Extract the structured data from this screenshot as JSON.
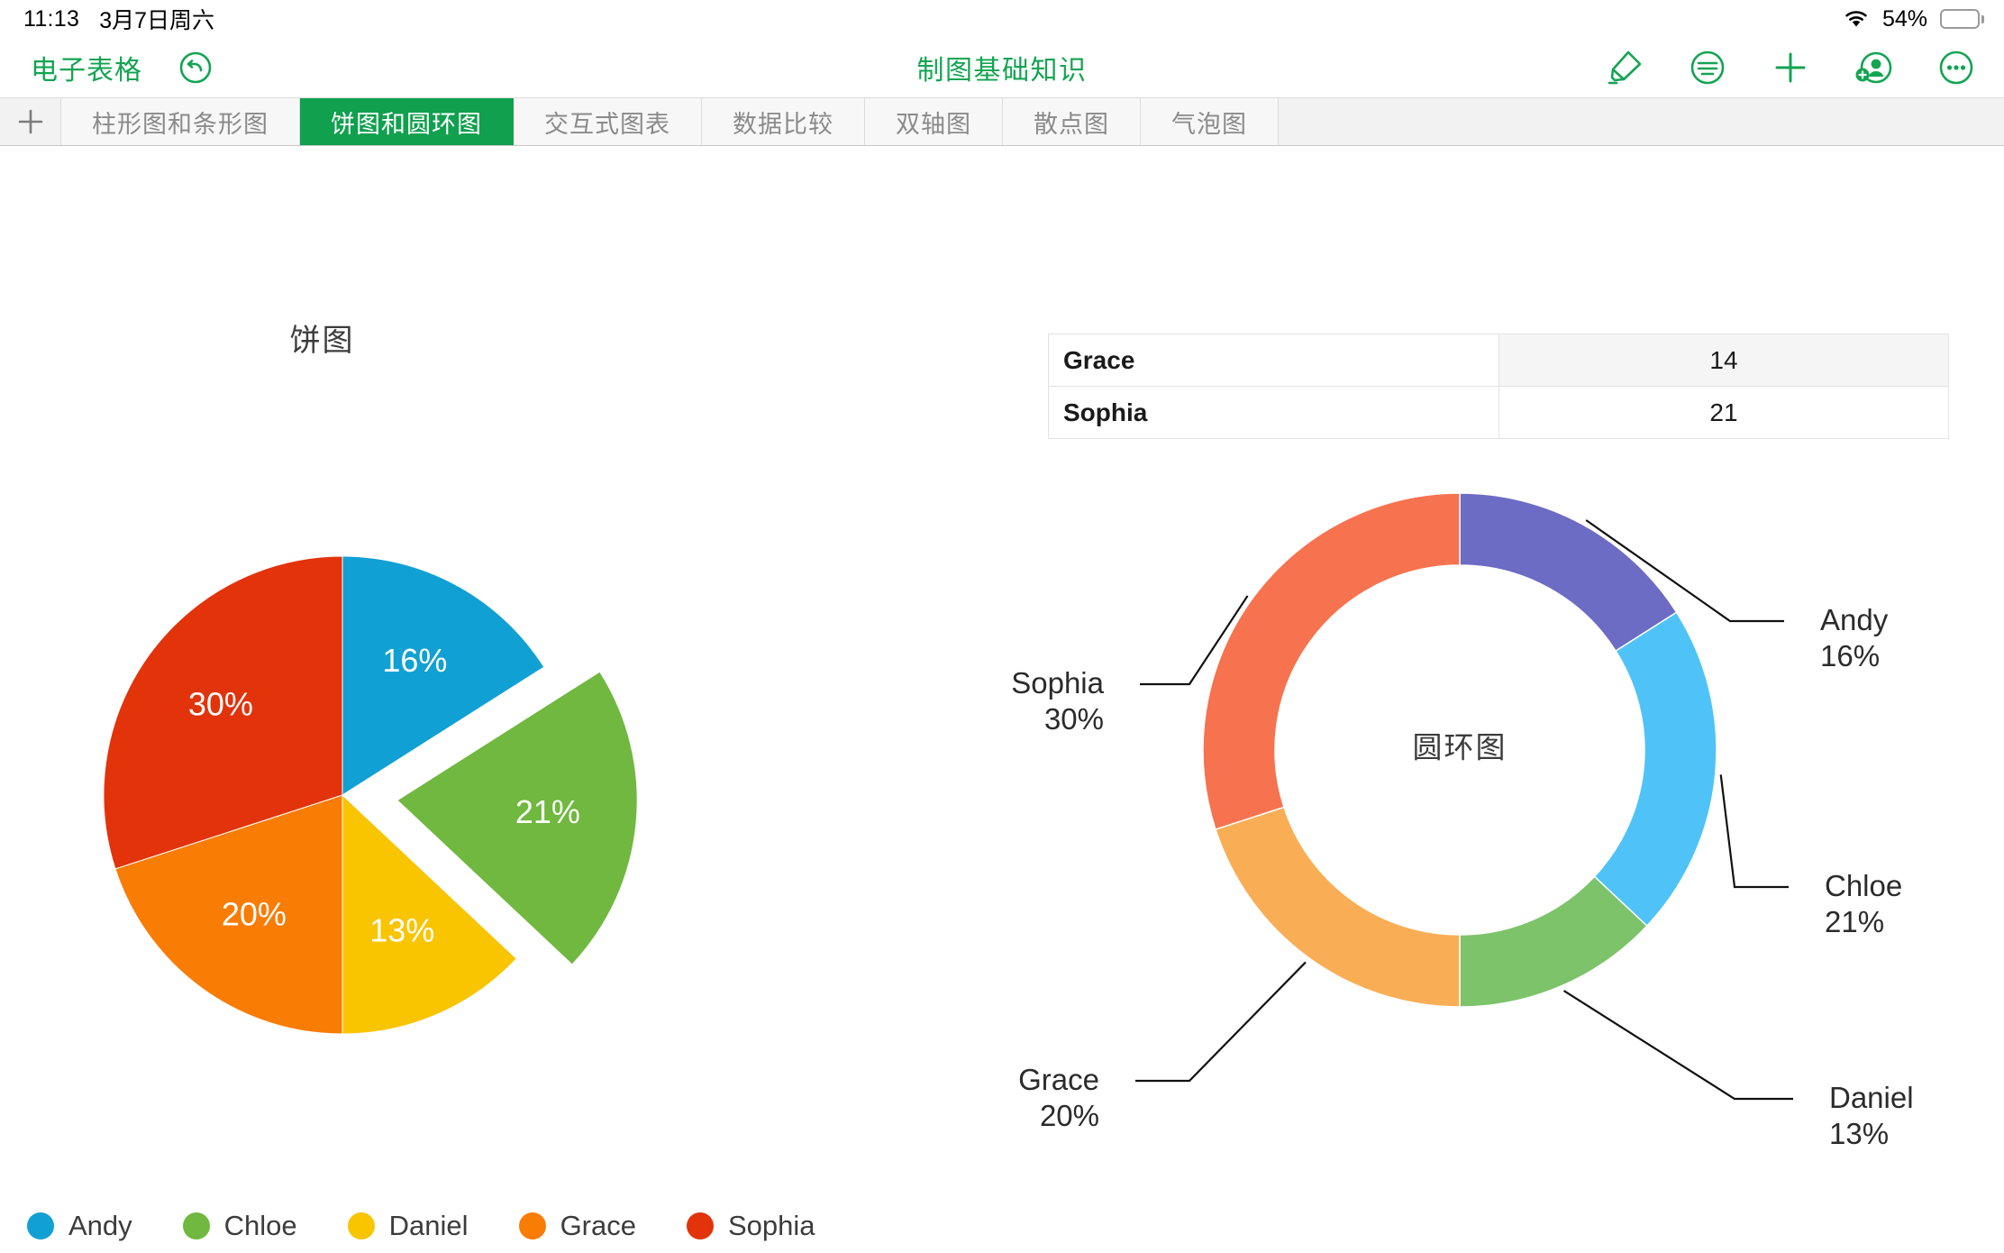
{
  "status_bar": {
    "time": "11:13",
    "date": "3月7日周六",
    "battery_percent": "54%",
    "battery_level": 54,
    "wifi_icon": "wifi-icon",
    "battery_icon": "battery-icon"
  },
  "toolbar": {
    "app_name": "电子表格",
    "undo_icon": "undo-icon",
    "doc_title": "制图基础知识",
    "actions": [
      {
        "name": "highlighter-icon",
        "label": "高亮笔"
      },
      {
        "name": "outline-icon",
        "label": "目录"
      },
      {
        "name": "plus-icon",
        "label": "新增"
      },
      {
        "name": "add-person-icon",
        "label": "协作"
      },
      {
        "name": "more-icon",
        "label": "更多"
      }
    ]
  },
  "sheet_tabs": {
    "add_label": "+",
    "active_index": 1,
    "items": [
      {
        "label": "柱形图和条形图"
      },
      {
        "label": "饼图和圆环图"
      },
      {
        "label": "交互式图表"
      },
      {
        "label": "数据比较"
      },
      {
        "label": "双轴图"
      },
      {
        "label": "散点图"
      },
      {
        "label": "气泡图"
      }
    ]
  },
  "data_table": {
    "rows": [
      {
        "name": "Grace",
        "value": "14",
        "shaded": true
      },
      {
        "name": "Sophia",
        "value": "21",
        "shaded": false
      }
    ]
  },
  "chart_data": [
    {
      "type": "pie",
      "title": "饼图",
      "chart_name": "pie-chart",
      "categories": [
        "Andy",
        "Chloe",
        "Daniel",
        "Grace",
        "Sophia"
      ],
      "values": [
        16,
        21,
        13,
        20,
        30
      ],
      "labels": [
        "16%",
        "21%",
        "13%",
        "20%",
        "30%"
      ],
      "colors": [
        "#11A0D4",
        "#6CB martyr"
      ],
      "slice_colors": [
        "#11A0D4",
        "#70B83F",
        "#F9C400",
        "#F97C05",
        "#E2330A"
      ],
      "exploded": [
        "Chloe"
      ],
      "legend": {
        "position": "bottom",
        "entries": [
          {
            "label": "Andy",
            "color": "#11A0D4"
          },
          {
            "label": "Chloe",
            "color": "#70B83F"
          },
          {
            "label": "Daniel",
            "color": "#F9C400"
          },
          {
            "label": "Grace",
            "color": "#F97C05"
          },
          {
            "label": "Sophia",
            "color": "#E2330A"
          }
        ]
      },
      "start_angle_deg": 0,
      "direction": "clockwise"
    },
    {
      "type": "pie",
      "subtype": "donut",
      "title": "圆环图",
      "chart_name": "donut-chart",
      "center_label": "圆环图",
      "categories": [
        "Andy",
        "Chloe",
        "Daniel",
        "Grace",
        "Sophia"
      ],
      "values": [
        16,
        21,
        13,
        20,
        30
      ],
      "slice_colors": [
        "#6C6CC4",
        "#4FC3F7",
        "#7CC36A",
        "#F9AE56",
        "#F7724F"
      ],
      "callouts": [
        {
          "label": "Andy",
          "pct": "16%",
          "side": "right"
        },
        {
          "label": "Chloe",
          "pct": "21%",
          "side": "right"
        },
        {
          "label": "Daniel",
          "pct": "13%",
          "side": "right"
        },
        {
          "label": "Grace",
          "pct": "20%",
          "side": "left"
        },
        {
          "label": "Sophia",
          "pct": "30%",
          "side": "left"
        }
      ],
      "legend": {
        "position": "none"
      },
      "start_angle_deg": 0,
      "direction": "clockwise"
    }
  ],
  "colors": {
    "brand_green": "#13a452",
    "tab_active_green": "#10a04e"
  }
}
